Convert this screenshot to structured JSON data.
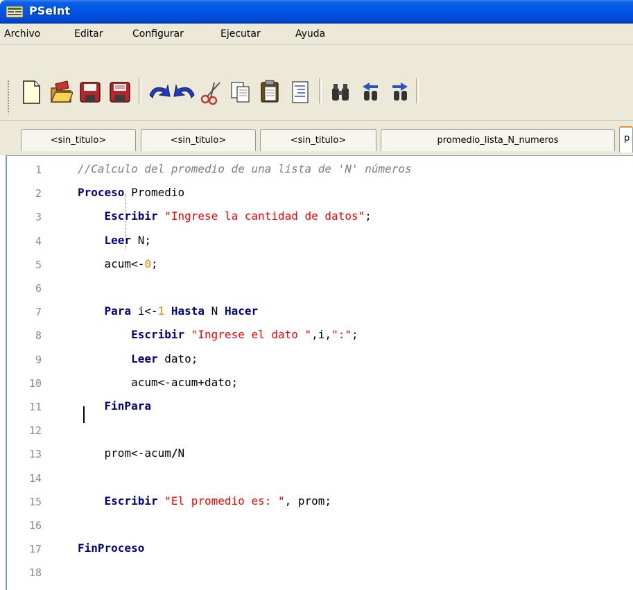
{
  "window": {
    "title": "PSeInt"
  },
  "menu": [
    "Archivo",
    "Editar",
    "Configurar",
    "Ejecutar",
    "Ayuda"
  ],
  "toolbar": {
    "buttons": [
      "new-file-icon",
      "open-folder-icon",
      "save-icon",
      "save-as-icon",
      "undo-icon",
      "redo-icon",
      "cut-icon",
      "copy-icon",
      "paste-icon",
      "indent-icon",
      "find-icon",
      "find-previous-icon",
      "find-next-icon",
      "run-icon"
    ]
  },
  "tabs": [
    "<sin_titulo>",
    "<sin_titulo>",
    "<sin_titulo>",
    "promedio_lista_N_numeros",
    "p"
  ],
  "editor": {
    "line_numbers": [
      "1",
      "2",
      "3",
      "4",
      "5",
      "6",
      "7",
      "8",
      "9",
      "10",
      "11",
      "12",
      "13",
      "14",
      "15",
      "16",
      "17",
      "18"
    ],
    "lines": [
      [
        {
          "t": "//Calculo del promedio de una lista de 'N' números",
          "c": "cmt"
        }
      ],
      [
        {
          "t": "Proceso",
          "c": "kw"
        },
        {
          "t": " Promedio",
          "c": ""
        }
      ],
      [
        {
          "t": "    ",
          "c": ""
        },
        {
          "t": "Escribir",
          "c": "kw"
        },
        {
          "t": " ",
          "c": ""
        },
        {
          "t": "\"Ingrese la cantidad de datos\"",
          "c": "str"
        },
        {
          "t": ";",
          "c": ""
        }
      ],
      [
        {
          "t": "    ",
          "c": ""
        },
        {
          "t": "Leer",
          "c": "kw"
        },
        {
          "t": " N;",
          "c": ""
        }
      ],
      [
        {
          "t": "    acum<-",
          "c": ""
        },
        {
          "t": "0",
          "c": "num"
        },
        {
          "t": ";",
          "c": ""
        }
      ],
      [],
      [
        {
          "t": "    ",
          "c": ""
        },
        {
          "t": "Para",
          "c": "kw"
        },
        {
          "t": " i<-",
          "c": ""
        },
        {
          "t": "1",
          "c": "num"
        },
        {
          "t": " ",
          "c": ""
        },
        {
          "t": "Hasta",
          "c": "kw"
        },
        {
          "t": " N ",
          "c": ""
        },
        {
          "t": "Hacer",
          "c": "kw"
        }
      ],
      [
        {
          "t": "        ",
          "c": ""
        },
        {
          "t": "Escribir",
          "c": "kw"
        },
        {
          "t": " ",
          "c": ""
        },
        {
          "t": "\"Ingrese el dato \"",
          "c": "str"
        },
        {
          "t": ",i,",
          "c": ""
        },
        {
          "t": "\":\"",
          "c": "str"
        },
        {
          "t": ";",
          "c": ""
        }
      ],
      [
        {
          "t": "        ",
          "c": ""
        },
        {
          "t": "Leer",
          "c": "kw"
        },
        {
          "t": " dato;",
          "c": ""
        }
      ],
      [
        {
          "t": "        acum<-acum+dato;",
          "c": ""
        }
      ],
      [
        {
          "t": "    ",
          "c": ""
        },
        {
          "t": "FinPara",
          "c": "kw"
        }
      ],
      [],
      [
        {
          "t": "    prom<-acum",
          "c": ""
        },
        {
          "t": "/",
          "c": "op"
        },
        {
          "t": "N",
          "c": ""
        }
      ],
      [],
      [
        {
          "t": "    ",
          "c": ""
        },
        {
          "t": "Escribir",
          "c": "kw"
        },
        {
          "t": " ",
          "c": ""
        },
        {
          "t": "\"El promedio es: \"",
          "c": "str"
        },
        {
          "t": ", prom;",
          "c": ""
        }
      ],
      [],
      [
        {
          "t": "FinProceso",
          "c": "kw"
        }
      ],
      []
    ]
  }
}
